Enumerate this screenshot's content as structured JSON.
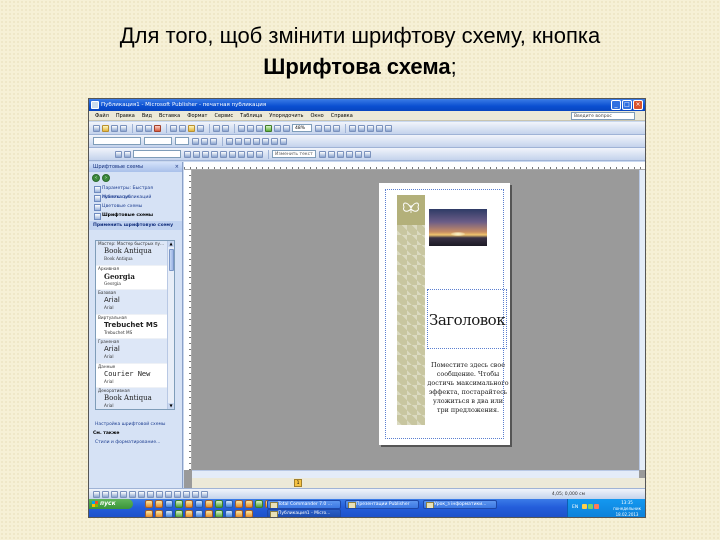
{
  "slide": {
    "title_line1": "Для того, щоб змінити шрифтову схему, кнопка",
    "title_line2_bold": "Шрифтова схема",
    "title_line2_tail": ";"
  },
  "window": {
    "title": "Публикация1 - Microsoft Publisher - печатная публикация",
    "menu": [
      "Файл",
      "Правка",
      "Вид",
      "Вставка",
      "Формат",
      "Сервис",
      "Таблица",
      "Упорядочить",
      "Окно",
      "Справка"
    ],
    "help_placeholder": "Введите вопрос",
    "zoom": "48%",
    "style_placeholder": "Изменить текст"
  },
  "taskpane": {
    "header": "Шрифтовые схемы",
    "links": [
      {
        "label": "Параметры: Быстрая публикация",
        "bold": false
      },
      {
        "label": "Макеты публикаций",
        "bold": false
      },
      {
        "label": "Цветовые схемы",
        "bold": false
      },
      {
        "label": "Шрифтовые схемы",
        "bold": true
      }
    ],
    "apply_section": "Применить шрифтовую схему",
    "schemes": [
      {
        "name": "Мастер: Мастер быстрых пу...",
        "font1": "Book Antiqua",
        "font2": "Book Antiqua",
        "cls": "serif",
        "selected": true
      },
      {
        "name": "Архивная",
        "font1": "Georgia",
        "font2": "Georgia",
        "cls": "serif boldf",
        "selected": false
      },
      {
        "name": "Базовая",
        "font1": "Arial",
        "font2": "Arial",
        "cls": "",
        "selected": true
      },
      {
        "name": "Виртуальная",
        "font1": "Trebuchet MS",
        "font2": "Trebuchet MS",
        "cls": "boldf",
        "selected": false
      },
      {
        "name": "Граненая",
        "font1": "Arial",
        "font2": "Arial",
        "cls": "",
        "selected": true
      },
      {
        "name": "Данные",
        "font1": "Courier New",
        "font2": "Arial",
        "cls": "mono",
        "selected": false
      },
      {
        "name": "Декоративная",
        "font1": "Book Antiqua",
        "font2": "Arial",
        "cls": "serif",
        "selected": true
      }
    ],
    "bottom_link": "Настройка шрифтовой схемы",
    "see_also": "См. также",
    "styles_link": "Стили и форматирование..."
  },
  "document": {
    "heading": "Заголовок",
    "body": "Поместите здесь свое сообщение. Чтобы достичь максимального эффекта, постарайтесь уложиться в два или три предложения.",
    "page_number": "1",
    "status": "4,05; 0,000 см"
  },
  "taskbar": {
    "start": "пуск",
    "tasks": [
      {
        "label": "Total Commander 7.0 ...",
        "active": false
      },
      {
        "label": "Презентации Publisher",
        "active": false
      },
      {
        "label": "Урок_з інформатики...",
        "active": false
      },
      {
        "label": "Публикация1 - Micro...",
        "active": true
      }
    ],
    "lang": "EN",
    "time": "13:35",
    "day": "понедельник",
    "date": "18.02.2013"
  }
}
